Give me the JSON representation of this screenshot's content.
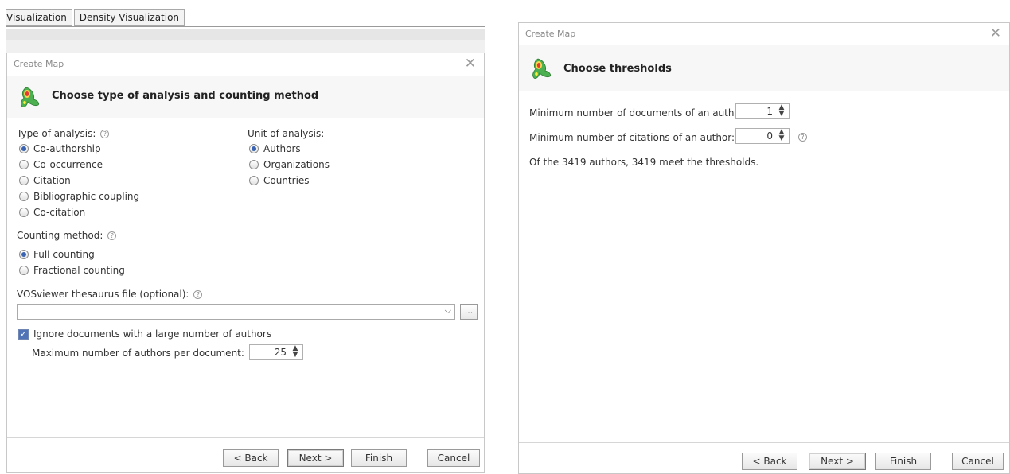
{
  "background": {
    "tabs": [
      "Visualization",
      "Density Visualization"
    ]
  },
  "left_dialog": {
    "window_title": "Create Map",
    "close_label": "✕",
    "header_title": "Choose type of analysis and counting method",
    "type_of_analysis": {
      "label": "Type of analysis:",
      "options": [
        "Co-authorship",
        "Co-occurrence",
        "Citation",
        "Bibliographic coupling",
        "Co-citation"
      ],
      "selected": "Co-authorship"
    },
    "unit_of_analysis": {
      "label": "Unit of analysis:",
      "options": [
        "Authors",
        "Organizations",
        "Countries"
      ],
      "selected": "Authors"
    },
    "counting_method": {
      "label": "Counting method:",
      "options": [
        "Full counting",
        "Fractional counting"
      ],
      "selected": "Full counting"
    },
    "thesaurus": {
      "label": "VOSviewer thesaurus file (optional):",
      "value": "",
      "browse_label": "..."
    },
    "ignore_docs": {
      "label": "Ignore documents with a large number of authors",
      "checked": true
    },
    "max_authors": {
      "label": "Maximum number of authors per document:",
      "value": "25"
    },
    "buttons": {
      "back": "< Back",
      "next": "Next >",
      "finish": "Finish",
      "cancel": "Cancel"
    }
  },
  "right_dialog": {
    "window_title": "Create Map",
    "close_label": "✕",
    "header_title": "Choose thresholds",
    "min_documents": {
      "label": "Minimum number of documents of an author:",
      "value": "1"
    },
    "min_citations": {
      "label": "Minimum number of citations of an author:",
      "value": "0"
    },
    "summary": "Of the 3419 authors, 3419 meet the thresholds.",
    "buttons": {
      "back": "< Back",
      "next": "Next >",
      "finish": "Finish",
      "cancel": "Cancel"
    }
  },
  "colors": {
    "accent": "#3a63b3",
    "header_bg": "#f7f7f7",
    "border": "#c8c8c8"
  },
  "icons": [
    "vosviewer-logo-icon",
    "help-icon",
    "chevron-down-icon",
    "spinner-arrows-icon",
    "checkmark-icon",
    "close-icon"
  ]
}
